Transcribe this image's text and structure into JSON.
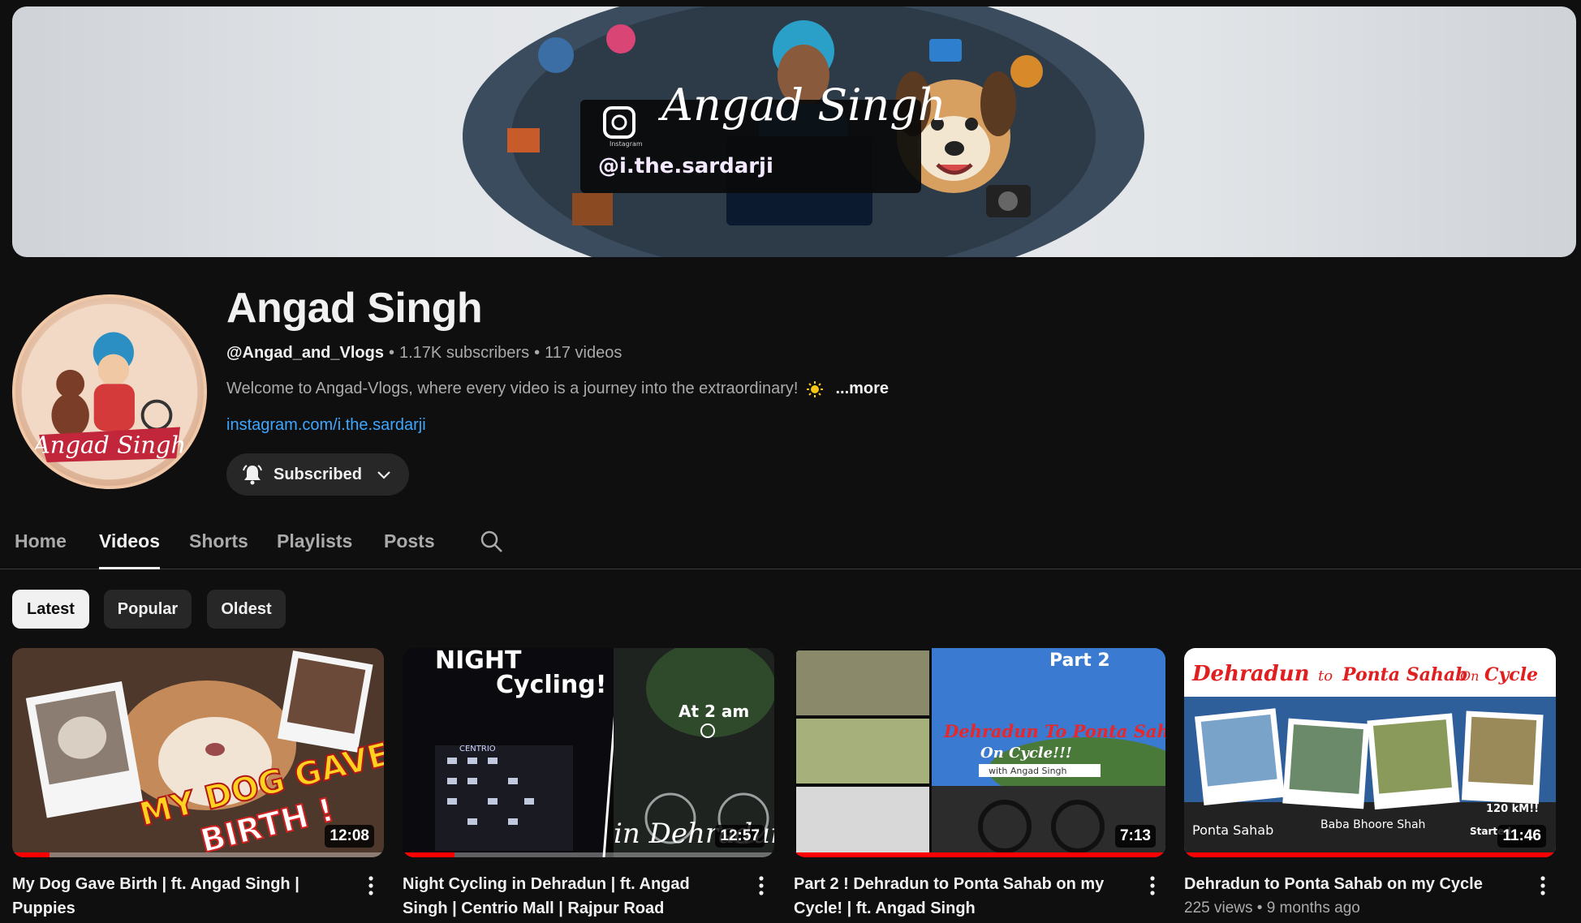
{
  "banner": {
    "title": "Angad Singh",
    "handle": "@i.the.sardarji",
    "platform_label": "Instagram"
  },
  "avatar": {
    "signature": "Angad Singh"
  },
  "channel": {
    "name": "Angad Singh",
    "handle": "@Angad_and_Vlogs",
    "subscribers": "1.17K subscribers",
    "videos": "117 videos",
    "description": "Welcome to Angad-Vlogs, where every video is a journey into the extraordinary!",
    "more_label": "...more",
    "link": "instagram.com/i.the.sardarji",
    "subscribe_label": "Subscribed"
  },
  "tabs": [
    {
      "label": "Home"
    },
    {
      "label": "Videos"
    },
    {
      "label": "Shorts"
    },
    {
      "label": "Playlists"
    },
    {
      "label": "Posts"
    }
  ],
  "chips": [
    {
      "label": "Latest"
    },
    {
      "label": "Popular"
    },
    {
      "label": "Oldest"
    }
  ],
  "videos": [
    {
      "title": "My Dog Gave Birth | ft. Angad Singh | Puppies",
      "duration": "12:08",
      "meta": "",
      "progress": 0.1,
      "thumb_text": [
        "MY DOG GAVE",
        "BIRTH !"
      ]
    },
    {
      "title": "Night Cycling in Dehradun | ft. Angad Singh | Centrio Mall | Rajpur Road",
      "duration": "12:57",
      "meta": "",
      "progress": 0.14,
      "thumb_text": [
        "NIGHT",
        "Cycling!",
        "At 2 am",
        "in Dehradun",
        "CENTRIO"
      ]
    },
    {
      "title": "Part 2 ! Dehradun to Ponta Sahab on my Cycle! | ft. Angad Singh",
      "duration": "7:13",
      "meta": "",
      "progress": 1.0,
      "thumb_text": [
        "Part 2",
        "Dehradun To Ponta Sahab",
        "On Cycle!!!",
        "with Angad Singh"
      ]
    },
    {
      "title": "Dehradun to Ponta Sahab on my Cycle",
      "duration": "11:46",
      "meta": "225 views • 9 months ago",
      "progress": 1.0,
      "thumb_text": [
        "Dehradun",
        "to",
        "Ponta Sahab",
        "On",
        "Cycle",
        "Ponta Sahab",
        "Baba Bhoore Shah",
        "120 kM!!",
        "Started"
      ]
    }
  ],
  "colors": {
    "accent": "#3ea6ff",
    "progress": "#ff0000",
    "background": "#0f0f0f"
  }
}
